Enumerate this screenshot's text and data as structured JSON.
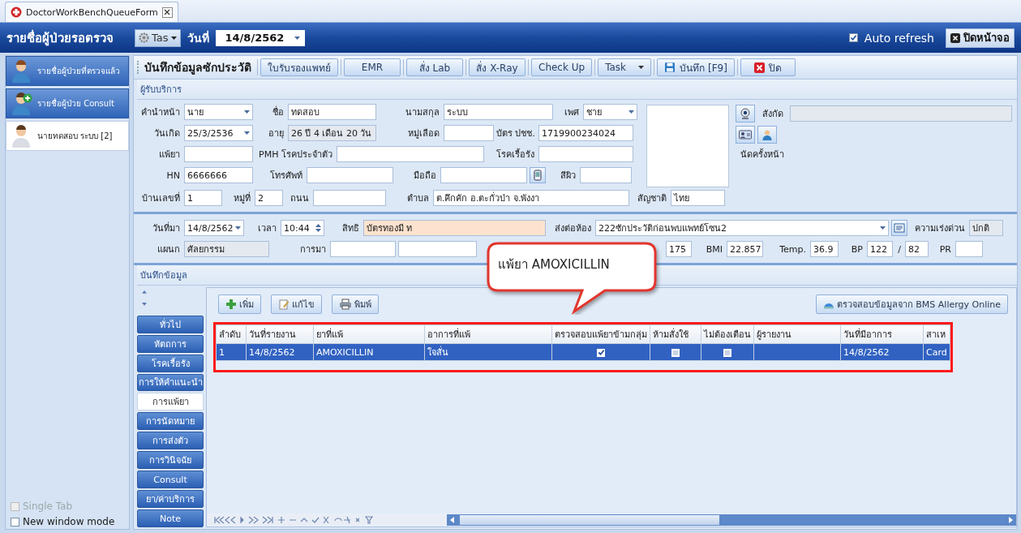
{
  "tab": {
    "title": "DoctorWorkBenchQueueForm"
  },
  "header": {
    "title": "รายชื่อผู้ป่วยรอตรวจ",
    "task_button": "Tas",
    "date_label": "วันที่",
    "date_value": "14/8/2562",
    "auto_refresh": {
      "label": "Auto refresh",
      "checked": true
    },
    "close_button": "ปิดหน้าจอ"
  },
  "sidebar": {
    "items": [
      {
        "label": "รายชื่อผู้ป่วยที่ตรวจแล้ว",
        "kind": "doctor",
        "selected": false
      },
      {
        "label": "รายชื่อผู้ป่วย Consult",
        "kind": "consult",
        "selected": false
      },
      {
        "label": "นายทดสอบ ระบบ [2]",
        "kind": "patient",
        "selected": true
      }
    ],
    "options": [
      {
        "label": "Single Tab",
        "checked": false,
        "disabled": true
      },
      {
        "label": "New window mode",
        "checked": false,
        "disabled": false
      }
    ]
  },
  "toolbar": {
    "title": "บันทึกข้อมูลซักประวัติ",
    "buttons": [
      {
        "label": "ใบรับรองแพทย์",
        "kind": "plain"
      },
      {
        "label": "EMR",
        "kind": "plain"
      },
      {
        "label": "สั่ง Lab",
        "kind": "plain"
      },
      {
        "label": "สั่ง X-Ray",
        "kind": "plain"
      },
      {
        "label": "Check Up",
        "kind": "plain"
      },
      {
        "label": "Task",
        "kind": "dropdown"
      },
      {
        "label": "บันทึก [F9]",
        "kind": "save"
      },
      {
        "label": "ปิด",
        "kind": "close"
      }
    ]
  },
  "patient": {
    "title": "ผู้รับบริการ",
    "lines": [
      {
        "fields": [
          {
            "kind": "label",
            "text": "คำนำหน้า"
          },
          {
            "kind": "select",
            "value": "นาย"
          },
          {
            "kind": "label",
            "text": "ชื่อ"
          },
          {
            "kind": "field",
            "value": "ทดสอบ"
          },
          {
            "kind": "label",
            "text": "นามสกุล"
          },
          {
            "kind": "field",
            "value": "ระบบ"
          },
          {
            "kind": "label",
            "text": "เพศ"
          },
          {
            "kind": "select",
            "value": "ชาย"
          }
        ]
      },
      {
        "fields": [
          {
            "kind": "label",
            "text": "วันเกิด"
          },
          {
            "kind": "select",
            "value": "25/3/2536"
          },
          {
            "kind": "label",
            "text": "อายุ"
          },
          {
            "kind": "readonly",
            "value": "26 ปี 4 เดือน 20 วัน"
          },
          {
            "kind": "label",
            "text": "หมู่เลือด"
          },
          {
            "kind": "field"
          },
          {
            "kind": "label",
            "text": "บัตร ปชช."
          },
          {
            "kind": "field",
            "value": "1719900234024"
          }
        ]
      },
      {
        "fields": [
          {
            "kind": "label",
            "text": "แพ้ยา"
          },
          {
            "kind": "field"
          },
          {
            "kind": "label",
            "text": "PMH โรคประจำตัว"
          },
          {
            "kind": "field"
          },
          {
            "kind": "label",
            "text": "โรคเรื้อรัง"
          },
          {
            "kind": "field"
          }
        ]
      },
      {
        "fields": [
          {
            "kind": "label",
            "text": "HN"
          },
          {
            "kind": "field",
            "value": "6666666"
          },
          {
            "kind": "label",
            "text": "โทรศัพท์"
          },
          {
            "kind": "field"
          },
          {
            "kind": "label",
            "text": "มือถือ"
          },
          {
            "kind": "field"
          },
          {
            "kind": "phone"
          },
          {
            "kind": "label",
            "text": "สีผิว"
          },
          {
            "kind": "field"
          }
        ]
      }
    ],
    "address": {
      "fields": [
        {
          "kind": "label",
          "text": "บ้านเลขที่"
        },
        {
          "kind": "field",
          "value": "1"
        },
        {
          "kind": "label",
          "text": "หมู่ที่"
        },
        {
          "kind": "field",
          "value": "2"
        },
        {
          "kind": "label",
          "text": "ถนน"
        },
        {
          "kind": "field"
        },
        {
          "kind": "label",
          "text": "ตำบล"
        },
        {
          "kind": "field",
          "value": "ต.คึกคัก อ.ตะกั่วป่า จ.พังงา"
        },
        {
          "kind": "label",
          "text": "สัญชาติ"
        },
        {
          "kind": "field",
          "value": "ไทย"
        }
      ]
    },
    "affiliation_label": "สังกัด",
    "next_appointment_label": "นัดครั้งหน้า"
  },
  "visit": {
    "lines": [
      {
        "fields": [
          {
            "kind": "label",
            "text": "วันที่มา"
          },
          {
            "kind": "select",
            "value": "14/8/2562"
          },
          {
            "kind": "label",
            "text": "เวลา"
          },
          {
            "kind": "spin",
            "value": "10:44"
          },
          {
            "kind": "label",
            "text": "สิทธิ"
          },
          {
            "kind": "highlight",
            "value": "บัตรทองมี ท"
          },
          {
            "kind": "label",
            "text": "ส่งต่อห้อง"
          },
          {
            "kind": "select",
            "value": "222ซักประวัติก่อนพบแพทย์โซน2"
          },
          {
            "kind": "list"
          },
          {
            "kind": "label",
            "text": "ความเร่งด่วน"
          },
          {
            "kind": "readonly",
            "value": "ปกติ"
          }
        ]
      },
      {
        "fields": [
          {
            "kind": "label",
            "text": "แผนก"
          },
          {
            "kind": "readonly",
            "value": "ศัลยกรรม"
          },
          {
            "kind": "label",
            "text": "การมา"
          },
          {
            "kind": "field"
          },
          {
            "kind": "field"
          },
          {
            "kind": "field",
            "value": "175"
          },
          {
            "kind": "label",
            "text": "BMI"
          },
          {
            "kind": "field",
            "value": "22.857"
          },
          {
            "kind": "label",
            "text": "Temp."
          },
          {
            "kind": "field",
            "value": "36.9"
          },
          {
            "kind": "label",
            "text": "BP"
          },
          {
            "kind": "field",
            "value": "122"
          },
          {
            "kind": "label",
            "text": "/"
          },
          {
            "kind": "field",
            "value": "82"
          },
          {
            "kind": "label",
            "text": "PR"
          },
          {
            "kind": "field"
          }
        ]
      }
    ]
  },
  "callout": {
    "text": "แพ้ยา AMOXICILLIN"
  },
  "record": {
    "title": "บันทึกข้อมูล",
    "tabs": [
      {
        "label": "ทั่วไป",
        "selected": false
      },
      {
        "label": "หัตถการ",
        "selected": false
      },
      {
        "label": "โรคเรื้อรัง",
        "selected": false
      },
      {
        "label": "การให้คำแนะนำ",
        "selected": false
      },
      {
        "label": "การแพ้ยา",
        "selected": true
      },
      {
        "label": "การนัดหมาย",
        "selected": false
      },
      {
        "label": "การส่งตัว",
        "selected": false
      },
      {
        "label": "การวินิจฉัย",
        "selected": false
      },
      {
        "label": "Consult",
        "selected": false
      },
      {
        "label": "ยา/ค่าบริการ",
        "selected": false
      },
      {
        "label": "Note",
        "selected": false
      }
    ],
    "actions": [
      {
        "label": "เพิ่ม",
        "kind": "add"
      },
      {
        "label": "แก้ไข",
        "kind": "edit"
      },
      {
        "label": "พิมพ์",
        "kind": "print"
      }
    ],
    "online_button": "ตรวจสอบข้อมูลจาก BMS Allergy Online",
    "table": {
      "columns": [
        "ลำดับ",
        "วันที่รายงาน",
        "ยาที่แพ้",
        "อาการที่แพ้",
        "ตรวจสอบแพ้ยาข้ามกลุ่ม",
        "ห้ามสั่งใช้",
        "ไม่ต้องเตือน",
        "ผู้รายงาน",
        "วันที่มีอาการ",
        "สาเห"
      ],
      "rows": [
        {
          "selected": true,
          "cells": [
            {
              "kind": "text",
              "text": "1"
            },
            {
              "kind": "text",
              "text": "14/8/2562"
            },
            {
              "kind": "text",
              "text": "AMOXICILLIN"
            },
            {
              "kind": "text",
              "text": "ใจสั่น"
            },
            {
              "kind": "check",
              "checked": true
            },
            {
              "kind": "check",
              "checked": false
            },
            {
              "kind": "check",
              "checked": false
            },
            {
              "kind": "text"
            },
            {
              "kind": "text",
              "text": "14/8/2562"
            },
            {
              "kind": "text",
              "text": "Card"
            }
          ]
        }
      ]
    }
  }
}
